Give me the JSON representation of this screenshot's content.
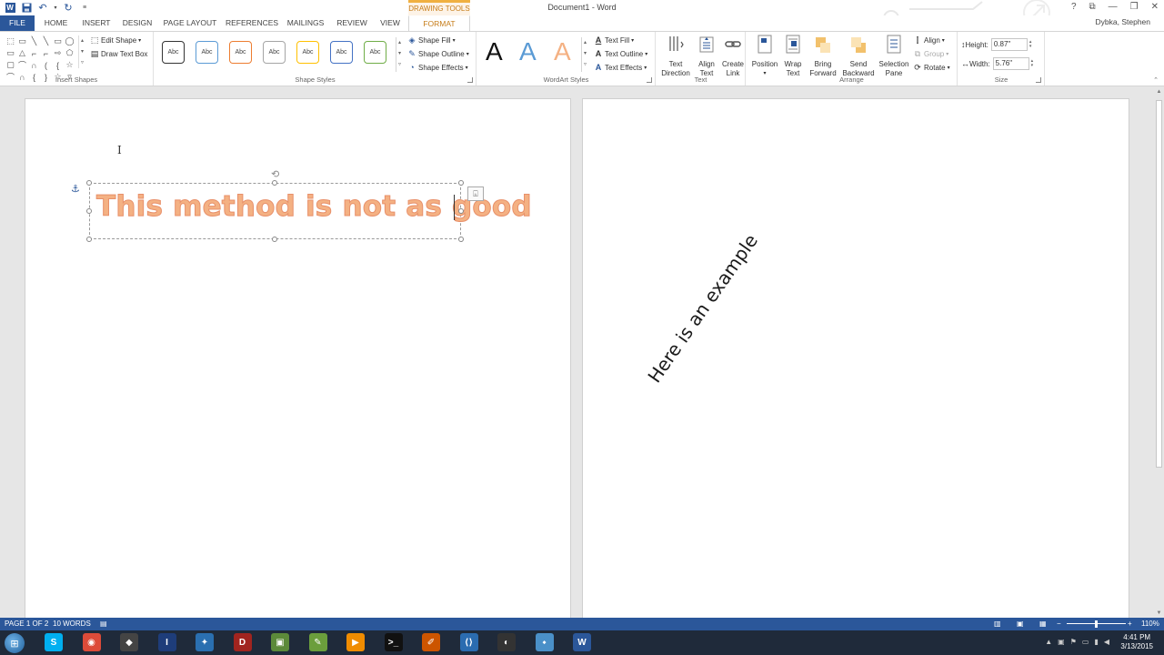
{
  "window": {
    "title": "Document1 - Word",
    "contextual_tab": "DRAWING TOOLS",
    "controls": [
      "?",
      "⧉",
      "—",
      "❐",
      "✕"
    ]
  },
  "user": {
    "name": "Dybka, Stephen"
  },
  "tabs": [
    "FILE",
    "HOME",
    "INSERT",
    "DESIGN",
    "PAGE LAYOUT",
    "REFERENCES",
    "MAILINGS",
    "REVIEW",
    "VIEW",
    "FORMAT"
  ],
  "ribbon": {
    "insert_shapes": {
      "label": "Insert Shapes",
      "edit_shape": "Edit Shape",
      "draw_text_box": "Draw Text Box",
      "shapes": [
        "⬚",
        "▭",
        "╲",
        "╲",
        "▭",
        "◯",
        "▭",
        "△",
        "⌐",
        "⌐",
        "⇨",
        "⬠",
        "▢",
        "⌒",
        "∩",
        "(",
        "{",
        "☆",
        "⌒",
        "∩",
        "{",
        "}",
        "☆",
        "▿"
      ]
    },
    "shape_styles": {
      "label": "Shape Styles",
      "swatch_text": "Abc",
      "swatch_colors": [
        "#333333",
        "#5b9bd5",
        "#ed7d31",
        "#a5a5a5",
        "#ffc000",
        "#4472c4",
        "#70ad47"
      ],
      "shape_fill": "Shape Fill",
      "shape_outline": "Shape Outline",
      "shape_effects": "Shape Effects"
    },
    "wordart_styles": {
      "label": "WordArt Styles",
      "letters": [
        {
          "char": "A",
          "color": "#111111"
        },
        {
          "char": "A",
          "color": "#5b9bd5"
        },
        {
          "char": "A",
          "color": "#f4b183"
        }
      ],
      "text_fill": "Text Fill",
      "text_outline": "Text Outline",
      "text_effects": "Text Effects"
    },
    "text": {
      "label": "Text",
      "text_direction": [
        "Text",
        "Direction"
      ],
      "align_text": [
        "Align",
        "Text"
      ],
      "create_link": [
        "Create",
        "Link"
      ]
    },
    "arrange": {
      "label": "Arrange",
      "position": [
        "Position",
        ""
      ],
      "wrap_text": [
        "Wrap",
        "Text"
      ],
      "bring_forward": [
        "Bring",
        "Forward"
      ],
      "send_backward": [
        "Send",
        "Backward"
      ],
      "selection_pane": [
        "Selection",
        "Pane"
      ],
      "align": "Align",
      "group": "Group",
      "rotate": "Rotate"
    },
    "size": {
      "label": "Size",
      "height_label": "Height:",
      "height_value": "0.87\"",
      "width_label": "Width:",
      "width_value": "5.76\""
    }
  },
  "document": {
    "page1": {
      "wordart_text": "This method is not as good"
    },
    "page2": {
      "rotated_text": "Here is an example"
    }
  },
  "status": {
    "page": "PAGE 1 OF 2",
    "words": "10 WORDS",
    "zoom": "110%"
  },
  "taskbar": {
    "icons": [
      {
        "name": "skype",
        "glyph": "S",
        "color": "#00aff0"
      },
      {
        "name": "chrome",
        "glyph": "◉",
        "color": "#dd4b39"
      },
      {
        "name": "app",
        "glyph": "◆",
        "color": "#444444"
      },
      {
        "name": "app",
        "glyph": "I",
        "color": "#1e3d7a"
      },
      {
        "name": "app",
        "glyph": "✦",
        "color": "#2a6fb0"
      },
      {
        "name": "dota",
        "glyph": "D",
        "color": "#a1241f"
      },
      {
        "name": "minecraft",
        "glyph": "▣",
        "color": "#5c8a3a"
      },
      {
        "name": "notepad",
        "glyph": "✎",
        "color": "#6b9e3c"
      },
      {
        "name": "media",
        "glyph": "▶",
        "color": "#f08c00"
      },
      {
        "name": "cmd",
        "glyph": ">_",
        "color": "#111111"
      },
      {
        "name": "editor",
        "glyph": "✐",
        "color": "#cc5500"
      },
      {
        "name": "vs",
        "glyph": "⟨⟩",
        "color": "#2b6cb0"
      },
      {
        "name": "obs",
        "glyph": "◐",
        "color": "#333333"
      },
      {
        "name": "app",
        "glyph": "⬩",
        "color": "#4a90c8"
      },
      {
        "name": "word",
        "glyph": "W",
        "color": "#2b579a"
      }
    ],
    "time": "4:41 PM",
    "date": "3/13/2015"
  }
}
